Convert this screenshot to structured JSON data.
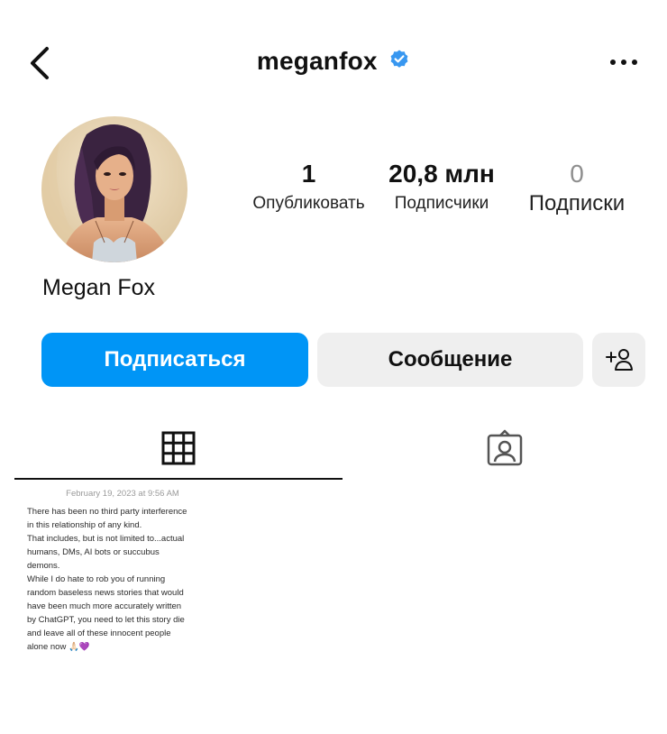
{
  "header": {
    "username": "meganfox",
    "verified_icon": "verified-badge-icon",
    "back_icon": "chevron-left-icon",
    "more_icon": "more-horizontal-icon"
  },
  "stats": [
    {
      "value": "1",
      "label": "Опубликовать"
    },
    {
      "value": "20,8 млн",
      "label": "Подписчики"
    },
    {
      "value": "0",
      "label": "Подписки"
    }
  ],
  "profile": {
    "name": "Megan Fox"
  },
  "actions": {
    "follow_label": "Подписаться",
    "message_label": "Сообщение",
    "add_person_icon": "add-person-icon"
  },
  "tabs": [
    {
      "icon": "grid-icon",
      "active": true
    },
    {
      "icon": "tagged-icon",
      "active": false
    }
  ],
  "post": {
    "date": "February 19, 2023 at 9:56 AM",
    "text": "There has been no third party interference\nin this relationship of any kind.\nThat includes, but is not limited to...actual\nhumans, DMs, AI bots or succubus\ndemons.\nWhile I do hate to rob you of running\nrandom baseless news stories that would\nhave been much more accurately written\nby ChatGPT, you need to let this story die\nand leave all of these innocent people\nalone now 🙏🏻💜"
  },
  "colors": {
    "accent": "#0095f6",
    "secondary_button": "#efefef",
    "verified": "#3897f0",
    "muted_text": "#8e8e8e"
  }
}
